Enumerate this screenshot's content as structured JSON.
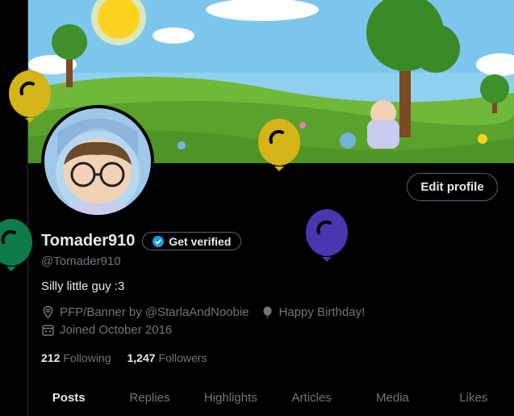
{
  "profile": {
    "display_name": "Tomader910",
    "verify_label": "Get verified",
    "handle": "@Tomader910",
    "bio": "Silly little guy :3",
    "link_text": "PFP/Banner by @StarlaAndNoobie",
    "birthday_text": "Happy Birthday!",
    "joined_text": "Joined October 2016",
    "following_count": "212",
    "following_label": "Following",
    "followers_count": "1,247",
    "followers_label": "Followers"
  },
  "actions": {
    "edit_profile_label": "Edit profile"
  },
  "tabs": [
    {
      "label": "Posts",
      "active": true
    },
    {
      "label": "Replies"
    },
    {
      "label": "Highlights"
    },
    {
      "label": "Articles"
    },
    {
      "label": "Media"
    },
    {
      "label": "Likes"
    }
  ],
  "balloons": [
    {
      "color": "#d4b417"
    },
    {
      "color": "#d4b417"
    },
    {
      "color": "#0f7a4a"
    },
    {
      "color": "#4b35b0"
    }
  ],
  "colors": {
    "accent": "#1d9bf0",
    "text": "#e7e9ea",
    "muted": "#71767b",
    "border": "#536471"
  }
}
